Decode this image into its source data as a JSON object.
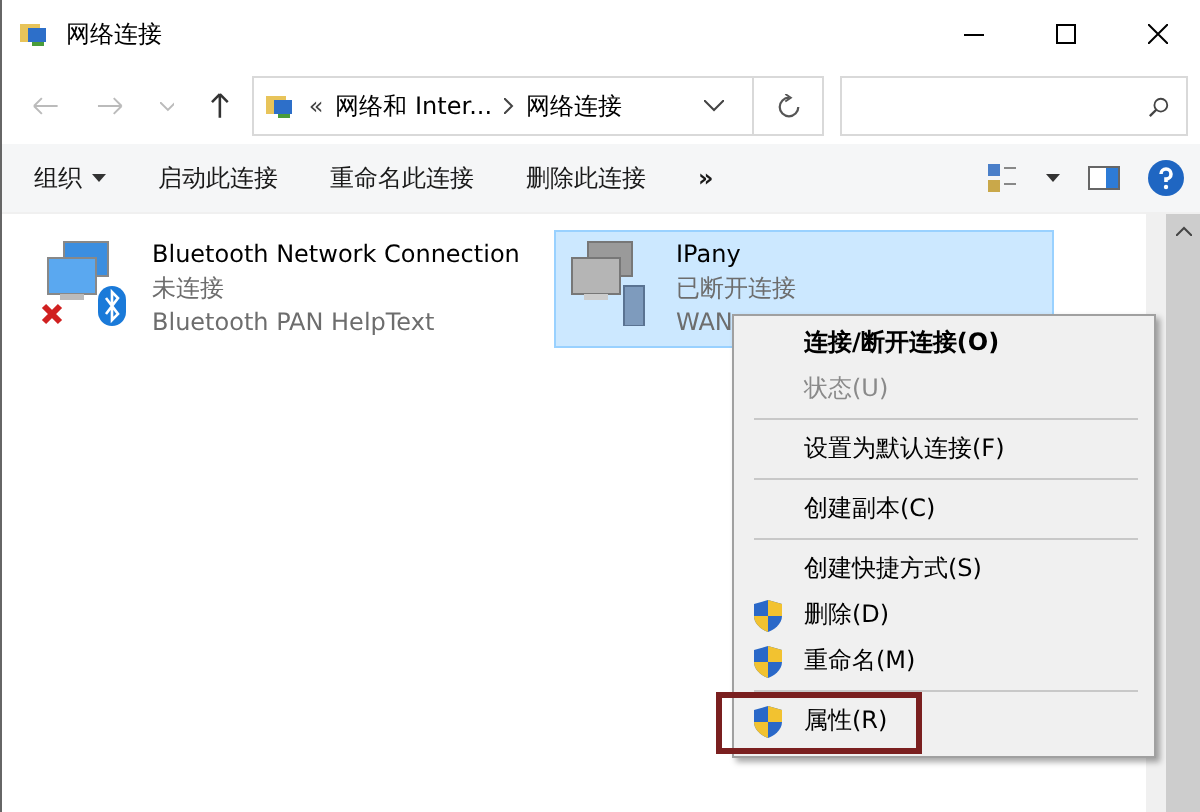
{
  "window": {
    "title": "网络连接"
  },
  "address": {
    "overflow": "«",
    "crumbs": [
      "网络和 Inter...",
      "网络连接"
    ]
  },
  "toolbar": {
    "items": [
      {
        "label": "组织",
        "dropdown": true
      },
      {
        "label": "启动此连接",
        "dropdown": false
      },
      {
        "label": "重命名此连接",
        "dropdown": false
      },
      {
        "label": "删除此连接",
        "dropdown": false
      }
    ],
    "more": "»"
  },
  "connections": [
    {
      "name": "Bluetooth Network Connection",
      "status": "未连接",
      "device": "Bluetooth PAN HelpText",
      "kind": "bluetooth",
      "selected": false
    },
    {
      "name": "IPany",
      "status": "已断开连接",
      "device": "WAN",
      "kind": "wan",
      "selected": true
    }
  ],
  "context_menu": [
    {
      "kind": "item",
      "label": "连接/断开连接(O)",
      "bold": true,
      "disabled": false,
      "shield": false,
      "highlighted": false
    },
    {
      "kind": "item",
      "label": "状态(U)",
      "bold": false,
      "disabled": true,
      "shield": false,
      "highlighted": false
    },
    {
      "kind": "separator"
    },
    {
      "kind": "item",
      "label": "设置为默认连接(F)",
      "bold": false,
      "disabled": false,
      "shield": false,
      "highlighted": false
    },
    {
      "kind": "separator"
    },
    {
      "kind": "item",
      "label": "创建副本(C)",
      "bold": false,
      "disabled": false,
      "shield": false,
      "highlighted": false
    },
    {
      "kind": "separator"
    },
    {
      "kind": "item",
      "label": "创建快捷方式(S)",
      "bold": false,
      "disabled": false,
      "shield": false,
      "highlighted": false
    },
    {
      "kind": "item",
      "label": "删除(D)",
      "bold": false,
      "disabled": false,
      "shield": true,
      "highlighted": false
    },
    {
      "kind": "item",
      "label": "重命名(M)",
      "bold": false,
      "disabled": false,
      "shield": true,
      "highlighted": false
    },
    {
      "kind": "separator"
    },
    {
      "kind": "item",
      "label": "属性(R)",
      "bold": false,
      "disabled": false,
      "shield": true,
      "highlighted": true
    }
  ]
}
